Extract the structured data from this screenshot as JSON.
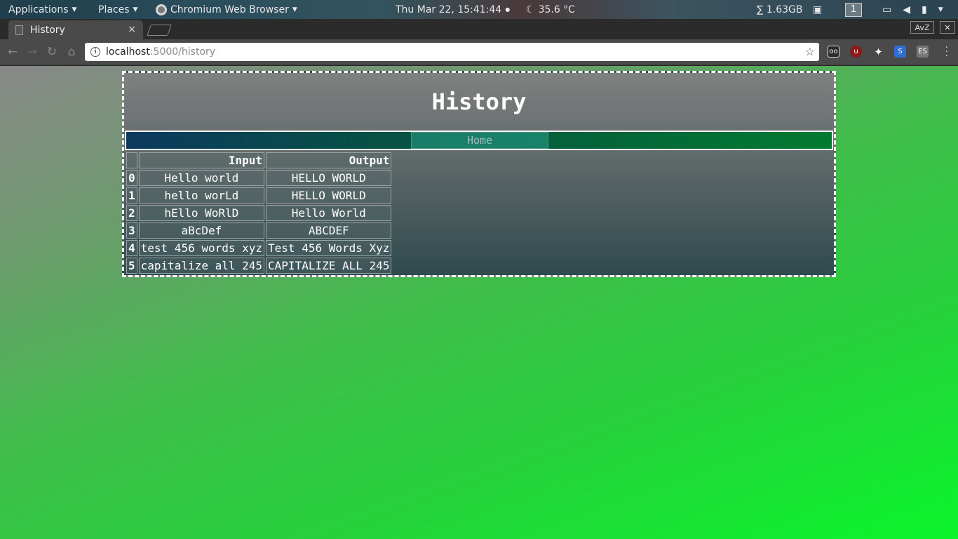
{
  "panel": {
    "applications": "Applications",
    "places": "Places",
    "active_app": "Chromium Web Browser",
    "clock": "Thu Mar 22, 15:41:44",
    "temperature": "35.6 °C",
    "memory": "∑ 1.63GB",
    "workspace": "1"
  },
  "browser": {
    "tab_title": "History",
    "tab_close": "×",
    "avz_label": "AvZ",
    "close_window": "✕",
    "url_host": "localhost",
    "url_path": ":5000/history",
    "extensions": [
      "ghostery",
      "ublock",
      "gnome",
      "s-ext",
      "es-ext"
    ]
  },
  "page": {
    "title": "History",
    "nav": {
      "home": "Home"
    },
    "table": {
      "headers": {
        "index": "",
        "input": "Input",
        "output": "Output"
      },
      "rows": [
        {
          "index": "0",
          "input": "Hello world",
          "output": "HELLO WORLD"
        },
        {
          "index": "1",
          "input": "hello worLd",
          "output": "HELLO WORLD"
        },
        {
          "index": "2",
          "input": "hEllo WoRlD",
          "output": "Hello World"
        },
        {
          "index": "3",
          "input": "aBcDef",
          "output": "ABCDEF"
        },
        {
          "index": "4",
          "input": "test 456 words xyz",
          "output": "Test 456 Words Xyz"
        },
        {
          "index": "5",
          "input": "capitalize all 245",
          "output": "CAPITALIZE ALL 245"
        }
      ]
    }
  },
  "colors": {
    "panel_text": "#e8e8e8",
    "page_bg_start": "#888888",
    "page_bg_end": "#0af52a",
    "nav_left": "#0c3a5e",
    "nav_right": "#027a30"
  }
}
